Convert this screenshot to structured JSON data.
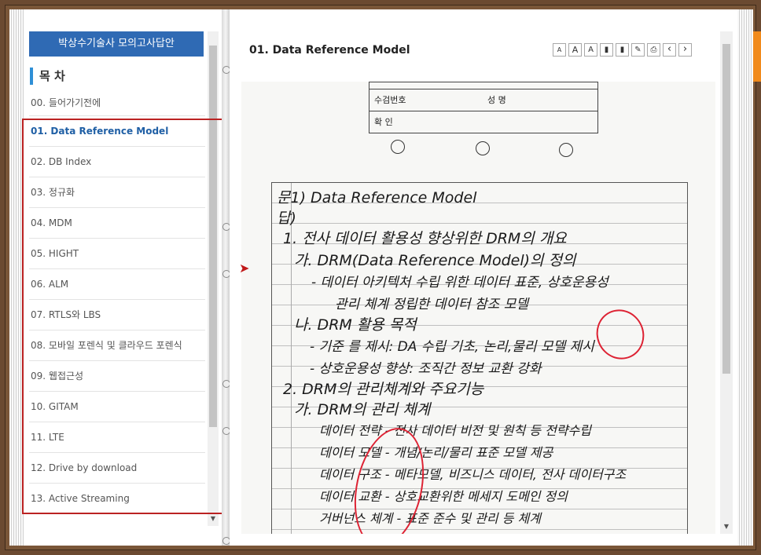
{
  "book": {
    "title": "박상수기술사 모의고사답안",
    "toc_heading": "목 차"
  },
  "toc": [
    {
      "label": "00. 들어가기전에",
      "active": false
    },
    {
      "label": "01. Data Reference Model",
      "active": true
    },
    {
      "label": "02. DB Index",
      "active": false
    },
    {
      "label": "03. 정규화",
      "active": false
    },
    {
      "label": "04. MDM",
      "active": false
    },
    {
      "label": "05. HIGHT",
      "active": false
    },
    {
      "label": "06. ALM",
      "active": false
    },
    {
      "label": "07. RTLS와 LBS",
      "active": false
    },
    {
      "label": "08. 모바일 포렌식 및 클라우드 포렌식",
      "active": false
    },
    {
      "label": "09. 웹접근성",
      "active": false
    },
    {
      "label": "10. GITAM",
      "active": false
    },
    {
      "label": "11. LTE",
      "active": false
    },
    {
      "label": "12. Drive by download",
      "active": false
    },
    {
      "label": "13. Active Streaming",
      "active": false
    }
  ],
  "content": {
    "title": "01. Data Reference Model"
  },
  "toolbar": [
    {
      "icon": "font-size-down-icon",
      "glyph": "A"
    },
    {
      "icon": "font-size-up-icon",
      "glyph": "A"
    },
    {
      "icon": "font-reset-icon",
      "glyph": "A"
    },
    {
      "icon": "bookmark-icon",
      "glyph": "▮"
    },
    {
      "icon": "bookmark-list-icon",
      "glyph": "▮"
    },
    {
      "icon": "memo-icon",
      "glyph": "✎"
    },
    {
      "icon": "print-icon",
      "glyph": "⎙"
    },
    {
      "icon": "prev-page-icon",
      "glyph": "‹"
    },
    {
      "icon": "next-page-icon",
      "glyph": "›"
    }
  ],
  "scan": {
    "form": {
      "exam_no_label": "수검번호",
      "name_label": "성  명",
      "confirm_label": "확  인"
    },
    "lines": [
      "문1) Data Reference Model",
      "답)",
      "1. 전사 데이터 활용성 향상위한 DRM의 개요",
      "가. DRM(Data Reference Model)의 정의",
      "- 데이터 아키텍처 수립 위한 데이터 표준, 상호운용성",
      "관리 체계 정립한 데이터 참조 모델",
      "나. DRM 활용 목적",
      "- 기준 를 제시: DA 수립 기초, 논리,물리 모델 제시",
      "- 상호운용성 향상: 조직간 정보 교환 강화",
      "2. DRM의 관리체계와 주요기능",
      "가. DRM의 관리 체계",
      "데이터 전략 - 전사 데이터 비전 및 원칙 등 전략수립",
      "데이터 모델 - 개념/논리/물리 표준 모델 제공",
      "데이터 구조 - 메타모델, 비즈니스 데이터, 전사 데이터구조",
      "데이터 교환 - 상호교환위한 메세지 도메인 정의",
      "거버넌스 체계 - 표준 준수 및 관리 등 체계"
    ]
  },
  "colors": {
    "title_bar": "#2f6ab4",
    "active_item": "#1f5fa5",
    "highlight_box": "#bb2222",
    "frame": "#6b4a31"
  }
}
